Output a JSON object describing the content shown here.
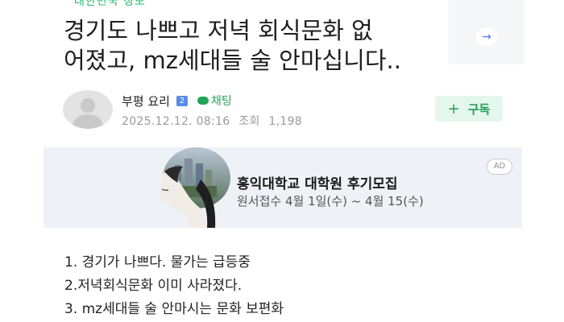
{
  "post": {
    "breadcrumb": "대한민국 정보",
    "title_lines": [
      "경기도 나쁘고 저녁 회식문화 없",
      "어졌고, mz세대들 술 안마십니다.."
    ]
  },
  "side_panel": {
    "icon": "arrow-right-icon"
  },
  "author": {
    "name": "부평 요리",
    "level_badge": "2",
    "chat_label": "채팅",
    "date": "2025.12.12. 08:16",
    "views_label": "조회",
    "views": "1,198"
  },
  "follow": {
    "label": "구독"
  },
  "ad": {
    "title": "홍익대학교 대학원 후기모집",
    "subtitle": "원서접수 4월 1일(수) ~ 4월 15(수)",
    "tag": "AD"
  },
  "body": {
    "lines": [
      "1. 경기가 나쁘다. 물가는 급등중",
      "2.저녁회식문화 이미 사라졌다.",
      "3. mz세대들 술 안마시는 문화 보편화"
    ]
  },
  "colors": {
    "accent_green": "#22a45a",
    "follow_bg": "#e5f7ec",
    "ad_bg": "#eef1f6",
    "badge_blue": "#5a8be8"
  }
}
